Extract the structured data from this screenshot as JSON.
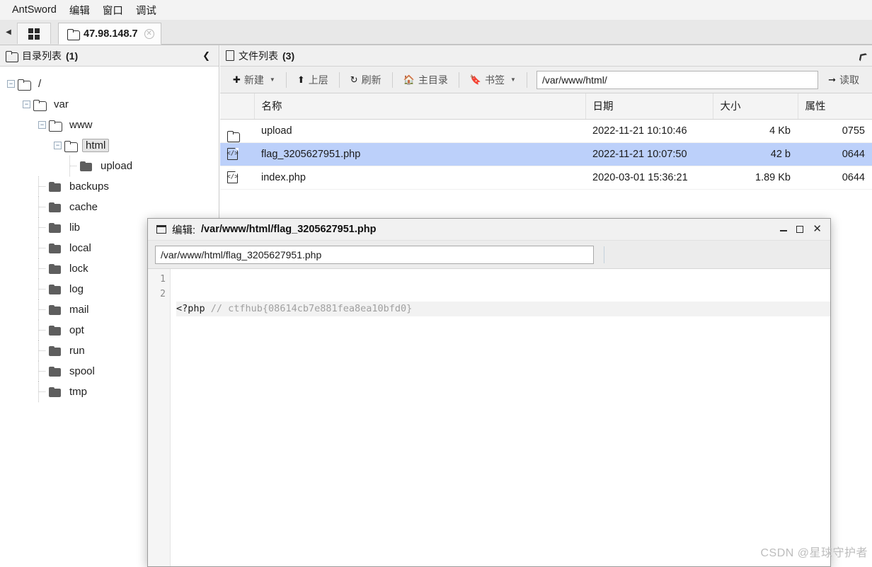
{
  "app": {
    "name": "AntSword",
    "menu": [
      "AntSword",
      "编辑",
      "窗口",
      "调试"
    ]
  },
  "tabbar": {
    "scroll_left_icon": "chevron-left-icon",
    "grid_button_icon": "grid-icon",
    "active_tab": {
      "icon": "folder-icon",
      "label": "47.98.148.7",
      "close_icon": "close-circle-icon"
    }
  },
  "dir_panel": {
    "icon": "folder-icon",
    "title": "目录列表",
    "count": "(1)",
    "collapse_icon": "chevron-left-icon",
    "tree": [
      {
        "label": "/",
        "depth": 0,
        "expanded": true,
        "icon": "folder-open-icon"
      },
      {
        "label": "var",
        "depth": 1,
        "expanded": true,
        "icon": "folder-open-icon"
      },
      {
        "label": "www",
        "depth": 2,
        "expanded": true,
        "icon": "folder-open-icon"
      },
      {
        "label": "html",
        "depth": 3,
        "expanded": true,
        "icon": "folder-open-icon",
        "selected": true
      },
      {
        "label": "upload",
        "depth": 4,
        "expanded": false,
        "icon": "folder-solid-icon"
      },
      {
        "label": "backups",
        "depth": 2,
        "expanded": false,
        "icon": "folder-solid-icon"
      },
      {
        "label": "cache",
        "depth": 2,
        "expanded": false,
        "icon": "folder-solid-icon"
      },
      {
        "label": "lib",
        "depth": 2,
        "expanded": false,
        "icon": "folder-solid-icon"
      },
      {
        "label": "local",
        "depth": 2,
        "expanded": false,
        "icon": "folder-solid-icon"
      },
      {
        "label": "lock",
        "depth": 2,
        "expanded": false,
        "icon": "folder-solid-icon"
      },
      {
        "label": "log",
        "depth": 2,
        "expanded": false,
        "icon": "folder-solid-icon"
      },
      {
        "label": "mail",
        "depth": 2,
        "expanded": false,
        "icon": "folder-solid-icon"
      },
      {
        "label": "opt",
        "depth": 2,
        "expanded": false,
        "icon": "folder-solid-icon"
      },
      {
        "label": "run",
        "depth": 2,
        "expanded": false,
        "icon": "folder-solid-icon"
      },
      {
        "label": "spool",
        "depth": 2,
        "expanded": false,
        "icon": "folder-solid-icon"
      },
      {
        "label": "tmp",
        "depth": 2,
        "expanded": false,
        "icon": "folder-solid-icon"
      }
    ]
  },
  "file_panel": {
    "icon": "file-icon",
    "title": "文件列表",
    "count": "(3)",
    "expand_icon": "chevron-expand-icon",
    "toolbar": {
      "new_label": "新建",
      "new_icon": "plus-circle-icon",
      "up_label": "上层",
      "up_icon": "arrow-up-icon",
      "refresh_label": "刷新",
      "refresh_icon": "refresh-icon",
      "home_label": "主目录",
      "home_icon": "home-icon",
      "bookmark_label": "书签",
      "bookmark_icon": "bookmark-icon",
      "path_value": "/var/www/html/",
      "path_placeholder": "/var/www/html/",
      "read_label": "读取",
      "read_icon": "arrow-right-icon"
    },
    "columns": [
      "",
      "名称",
      "日期",
      "大小",
      "属性"
    ],
    "rows": [
      {
        "icon": "folder-icon",
        "name": "upload",
        "date": "2022-11-21 10:10:46",
        "size": "4 Kb",
        "attr": "0755",
        "selected": false
      },
      {
        "icon": "code-file-icon",
        "name": "flag_3205627951.php",
        "date": "2022-11-21 10:07:50",
        "size": "42 b",
        "attr": "0644",
        "selected": true
      },
      {
        "icon": "code-file-icon",
        "name": "index.php",
        "date": "2020-03-01 15:36:21",
        "size": "1.89 Kb",
        "attr": "0644",
        "selected": false
      }
    ]
  },
  "editor_dialog": {
    "title_icon": "window-icon",
    "title_prefix": "编辑:",
    "title_path": "/var/www/html/flag_3205627951.php",
    "minimize_icon": "minimize-icon",
    "maximize_icon": "maximize-icon",
    "close_icon": "close-icon",
    "path_value": "/var/www/html/flag_3205627951.php",
    "path_placeholder": "/var/www/html/flag_3205627951.php",
    "lines": [
      "1",
      "2"
    ],
    "code_line_1_prefix": "<?php ",
    "code_line_1_comment": "// ctfhub{08614cb7e881fea8ea10bfd0}",
    "code_line_2": ""
  },
  "watermark": "CSDN @星球守护者"
}
